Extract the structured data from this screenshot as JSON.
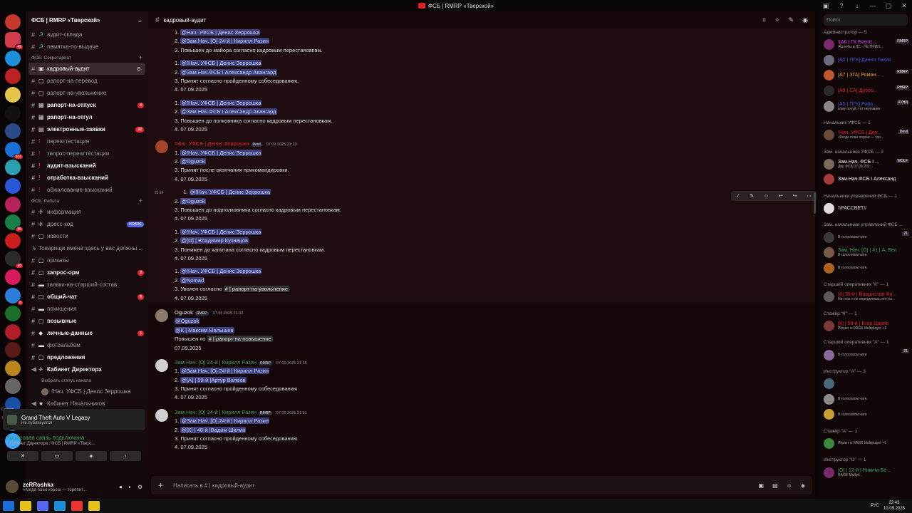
{
  "window": {
    "title": "ФСБ | RMRP «Тверской»"
  },
  "server_badges": [
    "49",
    "331",
    "95",
    "28",
    "6"
  ],
  "server_label": "Сервер",
  "server_new": "НОВОЕ",
  "sidebar": {
    "server_name": "ФСБ | RMRP «Тверской»",
    "items": [
      {
        "t": "ch",
        "hash": "#",
        "emoji": "☭",
        "label": "аудит-склада"
      },
      {
        "t": "ch",
        "hash": "#",
        "emoji": "☭",
        "label": "памятка-по-выдаче"
      },
      {
        "t": "cat",
        "label": "ФСБ: Секретариат"
      },
      {
        "t": "ch",
        "hash": "#",
        "emoji": "▣",
        "label": "кадровый-аудит",
        "active": true
      },
      {
        "t": "ch",
        "hash": "#",
        "emoji": "▢",
        "label": "рапорт-на-перевод"
      },
      {
        "t": "ch",
        "hash": "#",
        "emoji": "▢",
        "label": "рапорт-на-увольнение"
      },
      {
        "t": "ch",
        "hash": "#",
        "emoji": "▦",
        "label": "рапорт-на-отпуск",
        "bold": true,
        "badge": "4"
      },
      {
        "t": "ch",
        "hash": "#",
        "emoji": "▦",
        "label": "рапорт-на-отгул",
        "bold": true
      },
      {
        "t": "ch",
        "hash": "#",
        "emoji": "▤",
        "label": "электронные-заявки",
        "bold": true,
        "badge": "22"
      },
      {
        "t": "ch",
        "hash": "#",
        "emoji": "!",
        "label": "переаттестация"
      },
      {
        "t": "ch",
        "hash": "#",
        "emoji": "!",
        "label": "запрос-переаттестации"
      },
      {
        "t": "ch",
        "hash": "#",
        "emoji": "!",
        "label": "аудит-взысканий",
        "bold": true
      },
      {
        "t": "ch",
        "hash": "#",
        "emoji": "!",
        "label": "отработка-взысканий",
        "bold": true
      },
      {
        "t": "ch",
        "hash": "#",
        "emoji": "!",
        "label": "обжалование-взысканий"
      },
      {
        "t": "cat",
        "label": "ФСБ: Работа"
      },
      {
        "t": "ch",
        "hash": "#",
        "emoji": "✈",
        "label": "информация"
      },
      {
        "t": "ch",
        "hash": "#",
        "emoji": "✈",
        "label": "дресс-код",
        "new": "НОВОЕ"
      },
      {
        "t": "ch",
        "hash": "#",
        "emoji": "▢",
        "label": "новости"
      },
      {
        "t": "ch",
        "hash": "↳",
        "emoji": "",
        "label": "Товарищи имена здесь у вас должны ..."
      },
      {
        "t": "ch",
        "hash": "#",
        "emoji": "▢",
        "label": "приказы"
      },
      {
        "t": "ch",
        "hash": "#",
        "emoji": "▢",
        "label": "запрос-орм",
        "bold": true,
        "badge": "3"
      },
      {
        "t": "ch",
        "hash": "#",
        "emoji": "▬",
        "label": "заявки-на-старший-состав"
      },
      {
        "t": "ch",
        "hash": "#",
        "emoji": "▢",
        "label": "общий-чат",
        "bold": true,
        "badge": "6"
      },
      {
        "t": "ch",
        "hash": "#",
        "emoji": "▬",
        "label": "похищения"
      },
      {
        "t": "ch",
        "hash": "#",
        "emoji": "▢",
        "label": "позывные",
        "bold": true
      },
      {
        "t": "ch",
        "hash": "#",
        "emoji": "◆",
        "label": "личные-данные",
        "bold": true,
        "badge": "1"
      },
      {
        "t": "ch",
        "hash": "#",
        "emoji": "▬",
        "label": "фотоальбом"
      },
      {
        "t": "ch",
        "hash": "#",
        "emoji": "▢",
        "label": "предложения",
        "bold": true
      },
      {
        "t": "ch",
        "hash": "◀",
        "emoji": "✈",
        "label": "Кабинет Директора",
        "bold": true
      },
      {
        "t": "sub",
        "label": "Выбрать статус канала"
      },
      {
        "t": "vu",
        "label": "!Нач. УФСБ | Денис Зеррошка"
      },
      {
        "t": "ch",
        "hash": "◀",
        "emoji": "★",
        "label": "Кабинет Начальников"
      }
    ]
  },
  "game": {
    "title": "Grand Theft Auto V Legacy",
    "sub": "Не публикуется"
  },
  "voice": {
    "title": "Голосовая связь подключена",
    "sub": "| Кабинет Директора / ФСБ | RMRP «Тверс..."
  },
  "user": {
    "name": "zeRRoshka",
    "status": "«Когда план хорош — торопит..."
  },
  "channel": {
    "name": "кадровый-аудит",
    "placeholder": "Написать в # | кадровый-аудит"
  },
  "messages": [
    {
      "t": "l",
      "x": "1. @Нач. УФСБ | Денис Зеррошка",
      "hl": true
    },
    {
      "t": "l",
      "x": "2. @Зам.Нач. [О] 24-й | Кирилл Разин",
      "hl": true
    },
    {
      "t": "l",
      "x": "3. Повышен до майора согласно кадровым перестановкам.",
      "hl": true
    },
    {
      "t": "g",
      "hl": true
    },
    {
      "t": "l",
      "x": "1. @!Нач. УФСБ | Денис Зеррошка",
      "hl": true
    },
    {
      "t": "l",
      "x": "2. @Зам.Нач.ФСБ I Александр Авангард",
      "hl": true
    },
    {
      "t": "l",
      "x": "3. Принят согласно пройденному собеседованию.",
      "hl": true
    },
    {
      "t": "l",
      "x": "4. 07.09.2025",
      "hl": true
    },
    {
      "t": "g",
      "hl": true
    },
    {
      "t": "l",
      "x": "1. @!Нач. УФСБ | Денис Зеррошка",
      "hl": true
    },
    {
      "t": "l",
      "x": "2. @Зам.Нач.ФСБ I Александр Авангард",
      "hl": true
    },
    {
      "t": "l",
      "x": "3. Повышен до полковника согласно кадровым перестановкам.",
      "hl": true
    },
    {
      "t": "l",
      "x": "4. 07.09.2025",
      "hl": true
    },
    {
      "t": "G",
      "hl": true
    },
    {
      "t": "h",
      "name": "!Нач. УФСБ | Денис Зеррошка",
      "color": "#e0243b",
      "tag": "Devil",
      "ts": "07.09.2025 21:13",
      "hl": true
    },
    {
      "t": "l",
      "x": "1. @!Нач. УФСБ | Денис Зеррошка",
      "hl": true
    },
    {
      "t": "l",
      "x": "2. @Oguzok",
      "hl": true
    },
    {
      "t": "l",
      "x": "3. Принят после окончания прикомандировки.",
      "hl": true
    },
    {
      "t": "l",
      "x": "4. 07.09.2025",
      "hl": true
    },
    {
      "t": "g",
      "hl": true
    },
    {
      "t": "l",
      "x": "1. @!Нач. УФСБ | Денис Зеррошка",
      "hl": true,
      "time": "21:14"
    },
    {
      "t": "l",
      "x": "2. @Oguzok",
      "hl": true
    },
    {
      "t": "l",
      "x": "3. Повышен до подполковника согласно кадровым перестановкам.",
      "hl": true
    },
    {
      "t": "l",
      "x": "4. 07.09.2025",
      "hl": true
    },
    {
      "t": "g",
      "hl": true
    },
    {
      "t": "l",
      "x": "1. @!Нач. УФСБ | Денис Зеррошка",
      "hl": true
    },
    {
      "t": "l",
      "x": "2. @[О] | Владимир Кузнецов",
      "hl": true
    },
    {
      "t": "l",
      "x": "3. Понижен  до капитана согласно кадровым перестановкам.",
      "hl": true
    },
    {
      "t": "l",
      "x": "4. 07.09.2025",
      "hl": true
    },
    {
      "t": "g",
      "hl": true
    },
    {
      "t": "l",
      "x": "1. @!Нач. УФСБ | Денис Зеррошка",
      "hl": true
    },
    {
      "t": "l",
      "x": "2. @Nomad",
      "hl": true
    },
    {
      "t": "l",
      "x": "3. Уволен согласно # | рапорт-на-увольнение",
      "hl": true
    },
    {
      "t": "l",
      "x": "4. 07.09.2025",
      "hl": true
    },
    {
      "t": "G"
    },
    {
      "t": "h",
      "name": "Oguzok",
      "color": "#f2f3f5",
      "tag": "RMRP",
      "ts": "07.09.2025 21:32"
    },
    {
      "t": "l",
      "x": "@Oguzok"
    },
    {
      "t": "l",
      "x": "@К | Максим Малышев"
    },
    {
      "t": "l",
      "x": "Повышен по # | рапорт-на-повышение"
    },
    {
      "t": "l",
      "x": "07.09.2025"
    },
    {
      "t": "G"
    },
    {
      "t": "h",
      "name": "Зам.Нач. [О] 24-й | Кирилл Разин",
      "color": "#3ba55d",
      "tag": "RMRP",
      "ts": "07.09.2025 21:35"
    },
    {
      "t": "l",
      "x": "1. @Зам.Нач. [О] 24-й | Кирилл Разин"
    },
    {
      "t": "l",
      "x": "2. @[А] | 59-й |Артур Валеев"
    },
    {
      "t": "l",
      "x": "3. Принят согласно пройденному собеседованию"
    },
    {
      "t": "l",
      "x": "4. 07.09.2025"
    },
    {
      "t": "G"
    },
    {
      "t": "h",
      "name": "Зам.Нач. [О] 24-й | Кирилл Разин",
      "color": "#3ba55d",
      "tag": "RMRP",
      "ts": "07.09.2025 21:51"
    },
    {
      "t": "l",
      "x": "1. @Зам.Нач. [О] 24-й | Кирилл Разин"
    },
    {
      "t": "l",
      "x": "2. @[К] | 48-й |Вадим Шилин"
    },
    {
      "t": "l",
      "x": "3. Принят согласно пройденному собеседованию"
    },
    {
      "t": "l",
      "x": "4. 07.09.2025"
    }
  ],
  "search_placeholder": "Поиск",
  "members": [
    {
      "t": "r",
      "x": "Администратор — 5"
    },
    {
      "t": "m",
      "n": "![A6 | ГК Event] ...",
      "c": "#e040fb",
      "s": "Жалобы в ЛС - НЕ ПРИН...",
      "tag": "RMRP"
    },
    {
      "t": "m",
      "n": "[A5 | ПГК] Данил Тихий",
      "c": "#3b5bdb",
      "s": ""
    },
    {
      "t": "m",
      "n": "[A7 | ЗГА] Роман...",
      "c": "#f0a020",
      "s": "",
      "tag": "RMRP"
    },
    {
      "t": "m",
      "n": "[A9 | СА] Дубро...",
      "c": "#e0243b",
      "s": "",
      "tag": "RMRP"
    },
    {
      "t": "m",
      "n": "[A5 | ПГК] Райа...",
      "c": "#3b5bdb",
      "s": "кому похуй, тот неуязвим",
      "tag": "КУНИ"
    },
    {
      "t": "g"
    },
    {
      "t": "r",
      "x": "Начальник УФСБ — 1"
    },
    {
      "t": "m",
      "n": "!Нач. УФСБ | Ден...",
      "c": "#e0243b",
      "s": "«Когда план хорош — тор...",
      "tag": "Devil"
    },
    {
      "t": "g"
    },
    {
      "t": "r",
      "x": "Зам. начальника УФСБ — 2"
    },
    {
      "t": "m",
      "n": "Зам.Нач. ФСБ I ...",
      "c": "#f2f3f5",
      "s": "Дир ФСБ 07.09.202...",
      "tag": "WOLF"
    },
    {
      "t": "m",
      "n": "Зам.Нач.ФСБ I Александ...",
      "c": "#f2f3f5",
      "s": ""
    },
    {
      "t": "g"
    },
    {
      "t": "r",
      "x": "Начальники управлений ФСБ — 1"
    },
    {
      "t": "m",
      "n": "\\\\РАССВЕТ//",
      "c": "#ddd",
      "s": ""
    },
    {
      "t": "g"
    },
    {
      "t": "r",
      "x": "Зам. начальники управлений ФСБ ..."
    },
    {
      "t": "m",
      "n": "",
      "c": "#ddd",
      "s": "В голосовом чате",
      "tag": "21"
    },
    {
      "t": "m",
      "n": "Зам. Нач. [О] | 41 | А. Бел...",
      "c": "#3ba55d",
      "s": "В голосовом чате"
    },
    {
      "t": "m",
      "n": "",
      "c": "#ddd",
      "s": "В голосовом чате"
    },
    {
      "t": "g"
    },
    {
      "t": "r",
      "x": "Старший оперативник \"К\" — 1"
    },
    {
      "t": "m",
      "n": "[К] 36-й | Владислав Фи...",
      "c": "#e0243b",
      "s": "На глаз я не определишь, кто ты..."
    },
    {
      "t": "g"
    },
    {
      "t": "r",
      "x": "Стажёр \"К\" — 1"
    },
    {
      "t": "m",
      "n": "[К] | 58-й | Егор Царёв",
      "c": "#e0243b",
      "s": "Играет в RAGE Multiplayer +1"
    },
    {
      "t": "g"
    },
    {
      "t": "r",
      "x": "Старший оперативник \"А\" — 1"
    },
    {
      "t": "m",
      "n": "",
      "c": "#ddd",
      "s": "В голосовом чате",
      "tag": "21"
    },
    {
      "t": "g"
    },
    {
      "t": "r",
      "x": "Инструктор \"А\" — 3"
    },
    {
      "t": "m",
      "n": "",
      "c": "#ddd",
      "s": ""
    },
    {
      "t": "m",
      "n": "",
      "c": "#ddd",
      "s": "В голосовом чате"
    },
    {
      "t": "m",
      "n": "",
      "c": "#ddd",
      "s": "В голосовом чате"
    },
    {
      "t": "g"
    },
    {
      "t": "r",
      "x": "Стажёр \"А\" — 1"
    },
    {
      "t": "m",
      "n": "",
      "c": "#ddd",
      "s": "Играет в RAGE Multiplayer +1"
    },
    {
      "t": "g"
    },
    {
      "t": "r",
      "x": "Инструктор \"О\" — 1"
    },
    {
      "t": "m",
      "n": "[О] | 12-й | Никита Бе...",
      "c": "#3ba55d",
      "s": "RAGE Multipl..."
    }
  ],
  "tray": {
    "lang": "РУС",
    "time": "22:43",
    "date": "10.09.2025"
  }
}
